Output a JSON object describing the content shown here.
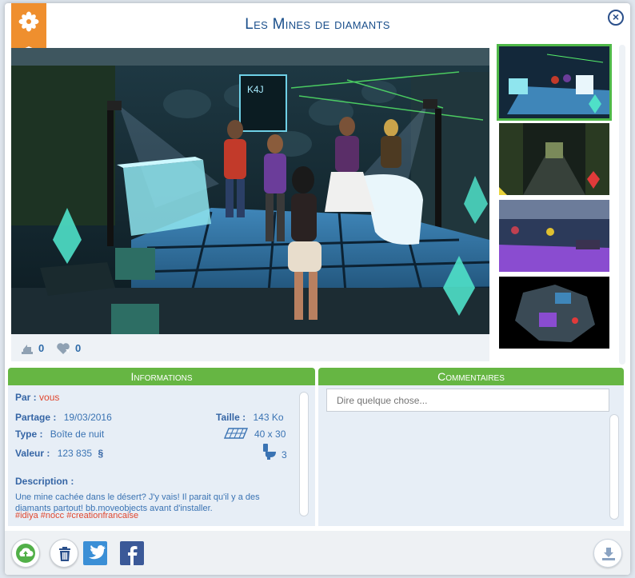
{
  "window": {
    "title": "Les Mines de diamants",
    "close_label": "×"
  },
  "main_image": {
    "sign_text": "K4J"
  },
  "stats": {
    "downloads": "0",
    "likes": "0"
  },
  "thumbnails": [
    {
      "label": "nightclub-dance-floor",
      "selected": true
    },
    {
      "label": "cave-corridor",
      "selected": false
    },
    {
      "label": "purple-lounge",
      "selected": false
    },
    {
      "label": "floor-plan",
      "selected": false
    }
  ],
  "info_panel": {
    "header": "Informations",
    "by_label": "Par :",
    "by_value": "vous",
    "shared_label": "Partage :",
    "shared_value": "19/03/2016",
    "size_label": "Taille :",
    "size_value": "143 Ko",
    "type_label": "Type :",
    "type_value": "Boîte de nuit",
    "lot_size": "40 x 30",
    "value_label": "Valeur :",
    "value_value": "123 835",
    "simoleon": "§",
    "bathrooms": "3",
    "description_label": "Description :",
    "description_text": "Une mine cachée dans le désert? J'y vais! Il parait qu'il y a des diamants partout! bb.moveobjects avant d'installer.",
    "tags": "#idiya #nocc #creationfrancaise"
  },
  "comments_panel": {
    "header": "Commentaires",
    "placeholder": "Dire quelque chose..."
  },
  "colors": {
    "accent_green": "#66b643",
    "title_blue": "#1a4f8b",
    "badge_orange": "#ef8f2e",
    "tag_red": "#e0472f"
  }
}
